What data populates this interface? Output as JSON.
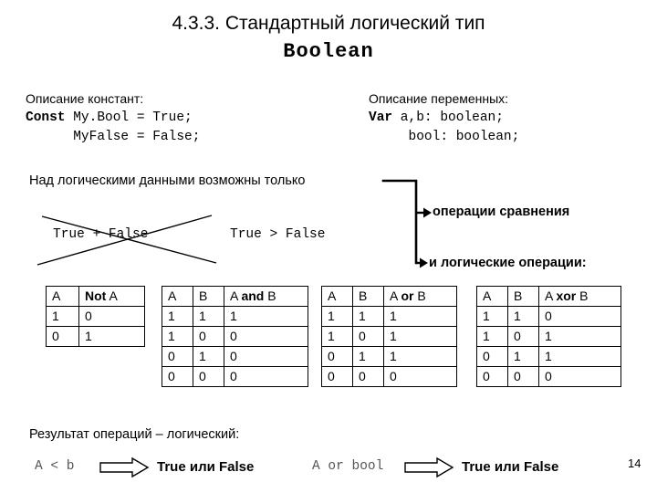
{
  "slide": {
    "title_line1": "4.3.3. Стандартный логический тип",
    "title_line2": "Boolean",
    "page_number": "14"
  },
  "declarations": {
    "constants": {
      "heading": "Описание констант:",
      "keyword": "Const",
      "line1": " My.Bool = True;",
      "line2": "      MyFalse = False;"
    },
    "variables": {
      "heading": "Описание переменных:",
      "keyword": "Var",
      "line1": " a,b: boolean;",
      "line2": "     bool: boolean;"
    }
  },
  "middle": {
    "lead_text": "Над логическими данными возможны только",
    "branch_1": "операции сравнения",
    "branch_2": "и логические операции:",
    "crossed_expression": "True + False",
    "valid_expression": "True > False"
  },
  "tables": [
    {
      "name": "not",
      "headers": [
        "A",
        "Not A"
      ],
      "header_bold_part": "Not",
      "rows": [
        [
          "1",
          "0"
        ],
        [
          "0",
          "1"
        ]
      ]
    },
    {
      "name": "and",
      "headers": [
        "A",
        "B",
        "A and B"
      ],
      "header_bold_part": "and",
      "rows": [
        [
          "1",
          "1",
          "1"
        ],
        [
          "1",
          "0",
          "0"
        ],
        [
          "0",
          "1",
          "0"
        ],
        [
          "0",
          "0",
          "0"
        ]
      ]
    },
    {
      "name": "or",
      "headers": [
        "A",
        "B",
        "A or B"
      ],
      "header_bold_part": "or",
      "rows": [
        [
          "1",
          "1",
          "1"
        ],
        [
          "1",
          "0",
          "1"
        ],
        [
          "0",
          "1",
          "1"
        ],
        [
          "0",
          "0",
          "0"
        ]
      ]
    },
    {
      "name": "xor",
      "headers": [
        "A",
        "B",
        "A xor B"
      ],
      "header_bold_part": "xor",
      "rows": [
        [
          "1",
          "1",
          "0"
        ],
        [
          "1",
          "0",
          "1"
        ],
        [
          "0",
          "1",
          "1"
        ],
        [
          "0",
          "0",
          "0"
        ]
      ]
    }
  ],
  "footer": {
    "heading": "Результат операций – логический:",
    "example1_expr": "A < b",
    "example1_result": "True или False",
    "example2_expr": "A or bool",
    "example2_result": "True или False"
  },
  "colors": {
    "ink": "#000000",
    "paper": "#ffffff",
    "muted_code": "#555555"
  }
}
